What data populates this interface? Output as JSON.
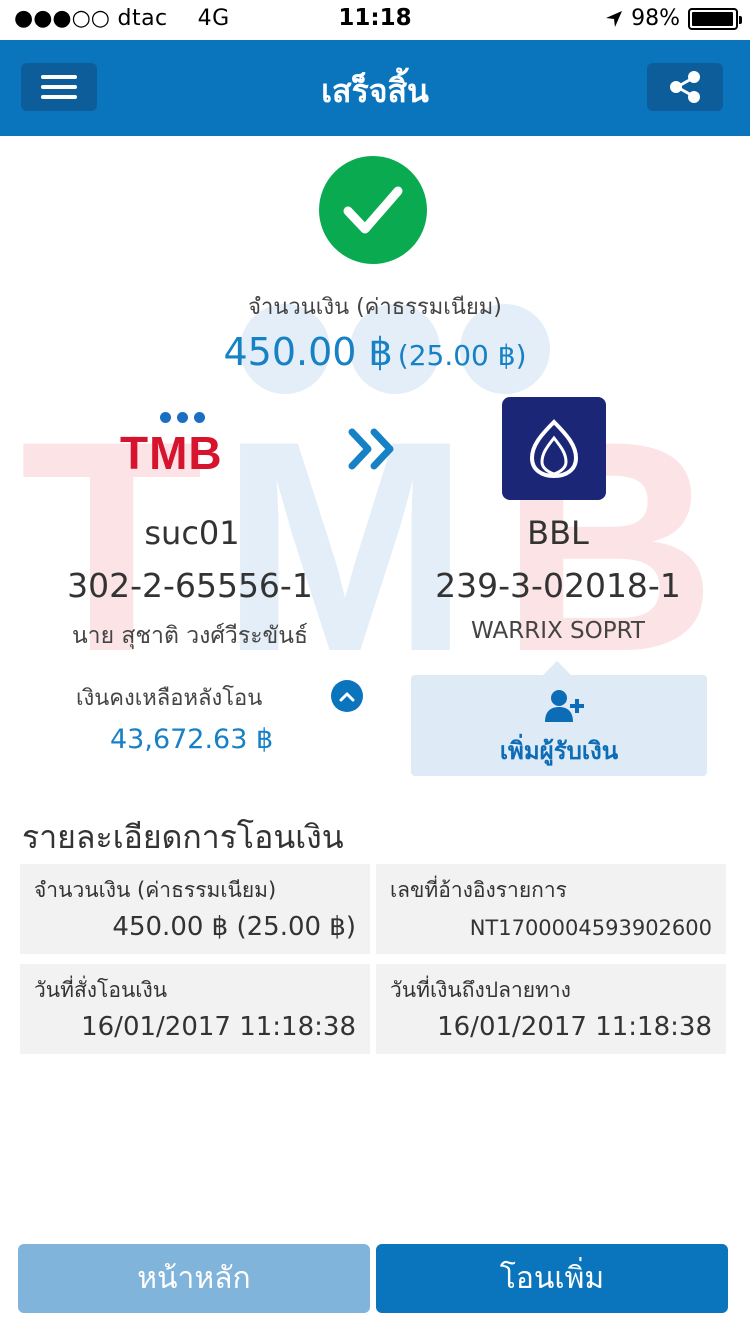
{
  "status_bar": {
    "carrier": "dtac",
    "network": "4G",
    "time": "11:18",
    "battery": "98%",
    "battery_level": 0.98,
    "signal_bars": 3,
    "signal_total": 5
  },
  "header": {
    "title": "เสร็จสิ้น",
    "menu_icon": "hamburger-icon",
    "share_icon": "share-icon"
  },
  "summary": {
    "amount_label": "จำนวนเงิน (ค่าธรรมเนียม)",
    "amount": "450.00 ฿",
    "fee": "(25.00 ฿)",
    "status_icon": "check-icon"
  },
  "from": {
    "bank": "TMB",
    "name": "suc01",
    "account_no": "302-2-65556-1",
    "owner": "นาย สุชาติ วงศ์วีระขันธ์"
  },
  "to": {
    "bank": "BBL",
    "account_no": "239-3-02018-1",
    "owner": "WARRIX SOPRT"
  },
  "balance": {
    "label": "เงินคงเหลือหลังโอน",
    "value": "43,672.63 ฿"
  },
  "add_payee": {
    "label": "เพิ่มผู้รับเงิน"
  },
  "details": {
    "title": "รายละเอียดการโอนเงิน",
    "items": [
      {
        "label": "จำนวนเงิน (ค่าธรรมเนียม)",
        "value": "450.00 ฿ (25.00 ฿)"
      },
      {
        "label": "เลขที่อ้างอิงรายการ",
        "value": "NT1700004593902600"
      },
      {
        "label": "วันที่สั่งโอนเงิน",
        "value": "16/01/2017 11:18:38"
      },
      {
        "label": "วันที่เงินถึงปลายทาง",
        "value": "16/01/2017 11:18:38"
      }
    ]
  },
  "buttons": {
    "home": "หน้าหลัก",
    "transfer_more": "โอนเพิ่ม"
  },
  "colors": {
    "primary": "#0a74bd",
    "success": "#0aaa50",
    "tmb_red": "#d7142e",
    "bbl_navy": "#1b2677",
    "amount_blue": "#1681c4"
  }
}
